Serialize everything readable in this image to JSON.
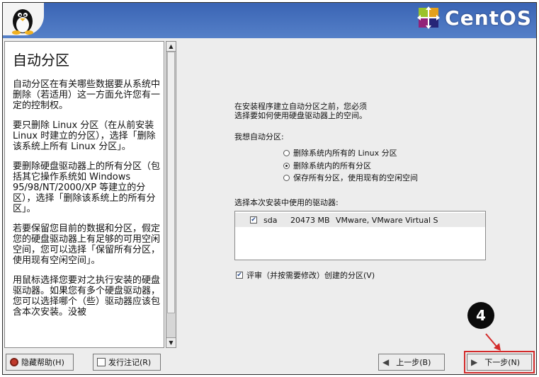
{
  "header": {
    "brand": "CentOS",
    "colors": {
      "bar": "#3a64b4",
      "accent": "#d32a2a"
    }
  },
  "help": {
    "title": "自动分区",
    "paragraphs": [
      "自动分区在有关哪些数据要从系统中删除（若适用）这一方面允许您有一定的控制权。",
      "要只删除 Linux 分区（在从前安装 Linux 时建立的分区），选择「删除该系统上所有 Linux 分区」。",
      "要删除硬盘驱动器上的所有分区（包括其它操作系统如 Windows 95/98/NT/2000/XP 等建立的分区），选择「删除该系统上的所有分区」。",
      "若要保留您目前的数据和分区，假定您的硬盘驱动器上有足够的可用空闲空间，您可以选择「保留所有分区，使用现有空闲空间」。",
      "用鼠标选择您要对之执行安装的硬盘驱动器。如果您有多个硬盘驱动器，您可以选择哪个（些）驱动器应该包含本次安装。没被"
    ]
  },
  "main": {
    "intro_line1": "在安装程序建立自动分区之前，您必须",
    "intro_line2": "选择要如何使用硬盘驱动器上的空间。",
    "want_label": "我想自动分区:",
    "options": [
      {
        "label": "删除系统内所有的 Linux 分区",
        "selected": false
      },
      {
        "label": "删除系统内的所有分区",
        "selected": true
      },
      {
        "label": "保存所有分区，使用现有的空闲空间",
        "selected": false
      }
    ],
    "drive_label": "选择本次安装中使用的驱动器:",
    "drives": [
      {
        "checked": true,
        "name": "sda",
        "size": "20473 MB",
        "model": "VMware, VMware Virtual S"
      }
    ],
    "review_label": "评审（并按需要修改）创建的分区(V)",
    "review_checked": true
  },
  "buttons": {
    "hide_help": "隐藏帮助(H)",
    "release_notes": "发行注记(R)",
    "back": "上一步(B)",
    "next": "下一步(N)"
  },
  "annotation": {
    "step": "4"
  }
}
